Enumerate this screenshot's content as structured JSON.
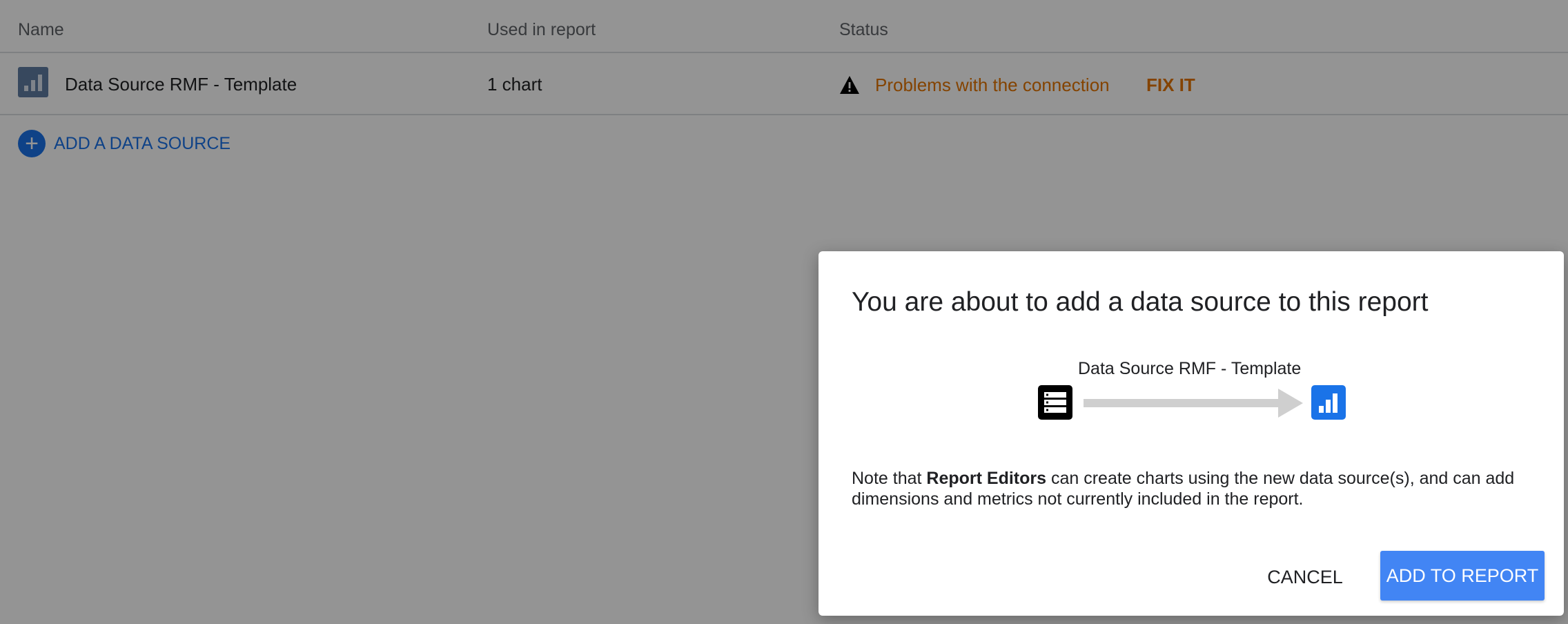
{
  "table": {
    "headers": {
      "name": "Name",
      "used_in_report": "Used in report",
      "status": "Status"
    },
    "rows": [
      {
        "name": "Data Source RMF - Template",
        "used_in_report": "1 chart",
        "status": "Problems with the connection",
        "action": "FIX IT"
      }
    ],
    "add_label": "ADD A DATA SOURCE"
  },
  "dialog": {
    "title": "You are about to add a data source to this report",
    "flow_label": "Data Source RMF - Template",
    "note_prefix": "Note that ",
    "note_bold": "Report Editors",
    "note_suffix": " can create charts using the new data source(s), and can add dimensions and metrics not currently included in the report.",
    "cancel_label": "CANCEL",
    "add_label": "ADD TO REPORT"
  },
  "icons": {
    "data_source": "bar-chart-icon",
    "warning": "warning-icon",
    "add": "plus-circle-icon",
    "source_db": "database-icon",
    "arrow": "arrow-right-icon",
    "report": "report-chart-icon"
  },
  "colors": {
    "accent": "#1a73e8",
    "primary_button": "#4285f4",
    "warning": "#e37400",
    "scrim": "rgba(0,0,0,0.42)"
  }
}
